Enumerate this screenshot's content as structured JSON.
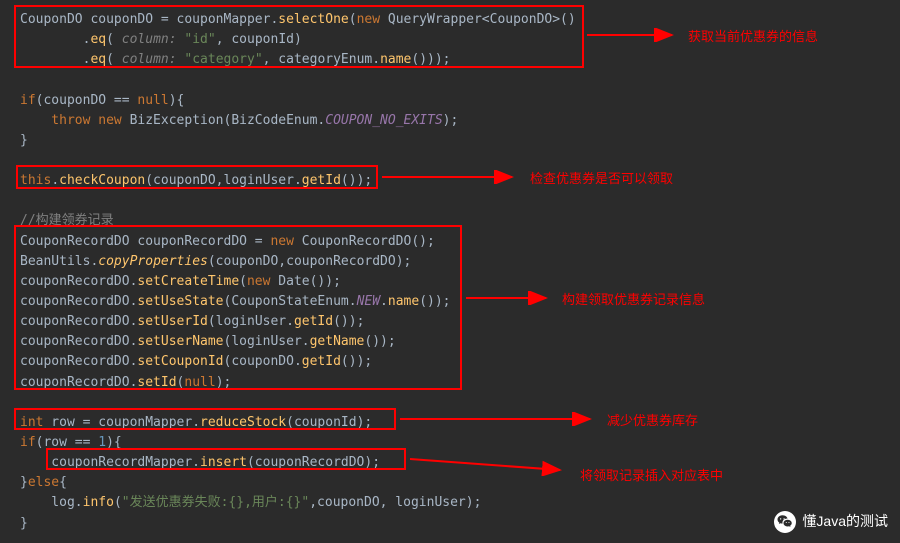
{
  "code": {
    "l1a": "CouponDO couponDO = couponMapper.",
    "l1b": "selectOne",
    "l1c": "(",
    "l1d": "new",
    "l1e": " QueryWrapper<CouponDO>()",
    "l2a": "        .",
    "l2b": "eq",
    "l2c": "( ",
    "l2d": "column:",
    "l2e": " \"id\"",
    "l2f": ", couponId)",
    "l3a": "        .",
    "l3b": "eq",
    "l3c": "( ",
    "l3d": "column:",
    "l3e": " \"category\"",
    "l3f": ", categoryEnum.",
    "l3g": "name",
    "l3h": "()));",
    "l4": "",
    "l5a": "if",
    "l5b": "(couponDO == ",
    "l5c": "null",
    "l5d": "){",
    "l6a": "    throw new",
    "l6b": " BizException(BizCodeEnum.",
    "l6c": "COUPON_NO_EXITS",
    "l6d": ");",
    "l7": "}",
    "l8": "",
    "l9a": "this",
    "l9b": ".",
    "l9c": "checkCoupon",
    "l9d": "(couponDO,loginUser.",
    "l9e": "getId",
    "l9f": "());",
    "l10": "",
    "l11": "//构建领券记录",
    "l12a": "CouponRecordDO couponRecordDO = ",
    "l12b": "new",
    "l12c": " CouponRecordDO();",
    "l13a": "BeanUtils.",
    "l13b": "copyProperties",
    "l13c": "(couponDO,couponRecordDO);",
    "l14a": "couponRecordDO.",
    "l14b": "setCreateTime",
    "l14c": "(",
    "l14d": "new",
    "l14e": " Date());",
    "l15a": "couponRecordDO.",
    "l15b": "setUseState",
    "l15c": "(CouponStateEnum.",
    "l15d": "NEW",
    "l15e": ".",
    "l15f": "name",
    "l15g": "());",
    "l16a": "couponRecordDO.",
    "l16b": "setUserId",
    "l16c": "(loginUser.",
    "l16d": "getId",
    "l16e": "());",
    "l17a": "couponRecordDO.",
    "l17b": "setUserName",
    "l17c": "(loginUser.",
    "l17d": "getName",
    "l17e": "());",
    "l18a": "couponRecordDO.",
    "l18b": "setCouponId",
    "l18c": "(couponDO.",
    "l18d": "getId",
    "l18e": "());",
    "l19a": "couponRecordDO.",
    "l19b": "setId",
    "l19c": "(",
    "l19d": "null",
    "l19e": ");",
    "l20": "",
    "l21a": "int",
    "l21b": " row = couponMapper.",
    "l21c": "reduceStock",
    "l21d": "(couponId);",
    "l22a": "if",
    "l22b": "(row == ",
    "l22c": "1",
    "l22d": "){",
    "l23a": "    couponRecordMapper.",
    "l23b": "insert",
    "l23c": "(couponRecordDO);",
    "l24a": "}",
    "l24b": "else",
    "l24c": "{",
    "l25a": "    log.",
    "l25b": "info",
    "l25c": "(",
    "l25d": "\"发送优惠券失败:{},用户:{}\"",
    "l25e": ",couponDO, loginUser);",
    "l26": "}"
  },
  "annotations": {
    "a1": "获取当前优惠券的信息",
    "a2": "检查优惠券是否可以领取",
    "a3": "构建领取优惠券记录信息",
    "a4": "减少优惠券库存",
    "a5": "将领取记录插入对应表中"
  },
  "watermark": "懂Java的测试"
}
